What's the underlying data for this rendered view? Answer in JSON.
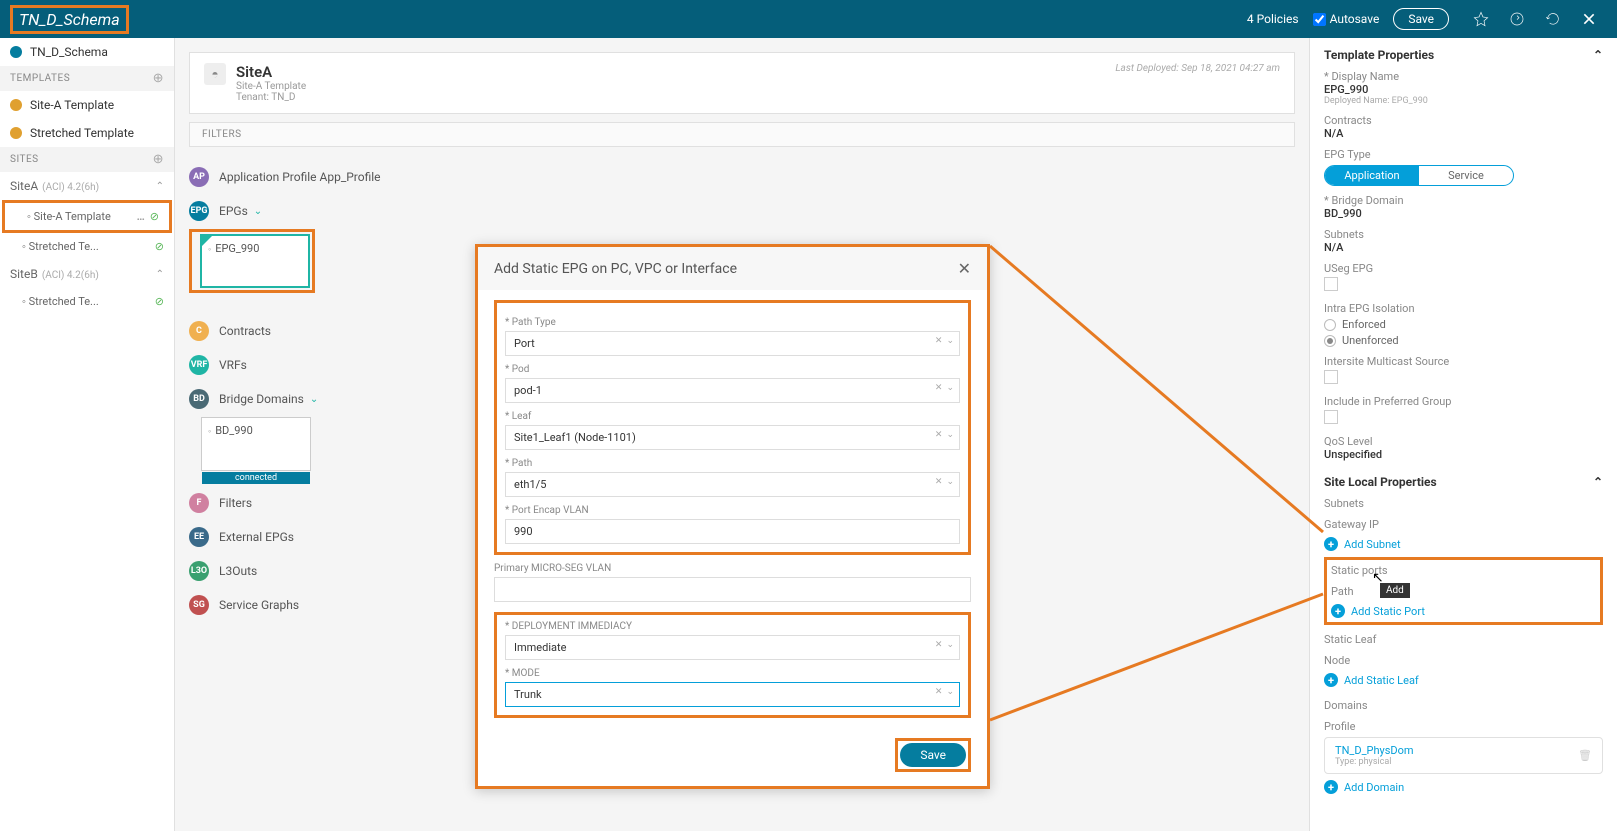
{
  "header": {
    "title": "TN_D_Schema",
    "policies": "4 Policies",
    "autosave": "Autosave",
    "save": "Save"
  },
  "sidebar": {
    "schema": "TN_D_Schema",
    "templates_label": "TEMPLATES",
    "tpl_a": "Site-A Template",
    "tpl_s": "Stretched Template",
    "sites_label": "SITES",
    "siteA": {
      "name": "SiteA",
      "meta": "(ACI) 4.2(6h)",
      "child1": "Site-A Template",
      "child2": "Stretched Te..."
    },
    "siteB": {
      "name": "SiteB",
      "meta": "(ACI) 4.2(6h)",
      "child1": "Stretched Te..."
    }
  },
  "canvas": {
    "title": "SiteA",
    "sub1": "Site-A Template",
    "sub2": "Tenant: TN_D",
    "deployed": "Last Deployed: Sep 18, 2021 04:27 am",
    "filters": "FILTERS",
    "sec_ap": "Application Profile App_Profile",
    "sec_epg": "EPGs",
    "epg_tile": "EPG_990",
    "sec_contracts": "Contracts",
    "sec_vrfs": "VRFs",
    "sec_bd": "Bridge Domains",
    "bd_tile": "BD_990",
    "bd_conn": "connected",
    "sec_filters2": "Filters",
    "sec_ext": "External EPGs",
    "sec_l3": "L3Outs",
    "sec_sg": "Service Graphs"
  },
  "modal": {
    "title": "Add Static EPG on PC, VPC or Interface",
    "path_type_l": "* Path Type",
    "path_type_v": "Port",
    "pod_l": "* Pod",
    "pod_v": "pod-1",
    "leaf_l": "* Leaf",
    "leaf_v": "Site1_Leaf1 (Node-1101)",
    "path_l": "* Path",
    "path_v": "eth1/5",
    "vlan_l": "* Port Encap VLAN",
    "vlan_v": "990",
    "mseg_l": "Primary MICRO-SEG VLAN",
    "dep_l": "* DEPLOYMENT IMMEDIACY",
    "dep_v": "Immediate",
    "mode_l": "* MODE",
    "mode_v": "Trunk",
    "save": "Save"
  },
  "props": {
    "title": "Template Properties",
    "dn_l": "* Display Name",
    "dn_v": "EPG_990",
    "dn_dep": "Deployed Name: EPG_990",
    "contracts_l": "Contracts",
    "contracts_v": "N/A",
    "epgtype_l": "EPG Type",
    "epgtype_app": "Application",
    "epgtype_svc": "Service",
    "bd_l": "* Bridge Domain",
    "bd_v": "BD_990",
    "subnets_l": "Subnets",
    "subnets_v": "N/A",
    "useg_l": "USeg EPG",
    "iso_l": "Intra EPG Isolation",
    "iso_enf": "Enforced",
    "iso_unenf": "Unenforced",
    "ims_l": "Intersite Multicast Source",
    "ipg_l": "Include in Preferred Group",
    "qos_l": "QoS Level",
    "qos_v": "Unspecified",
    "site_title": "Site Local Properties",
    "sub2_l": "Subnets",
    "gw_l": "Gateway IP",
    "add_subnet": "Add Subnet",
    "static_ports_l": "Static ports",
    "port_path_l": "Path",
    "add_static_port": "Add Static Port",
    "tooltip": "Add",
    "static_leaf_l": "Static Leaf",
    "node_l": "Node",
    "add_static_leaf": "Add Static Leaf",
    "domains_l": "Domains",
    "profile_l": "Profile",
    "dom_name": "TN_D_PhysDom",
    "dom_type": "Type: physical",
    "add_domain": "Add Domain"
  }
}
